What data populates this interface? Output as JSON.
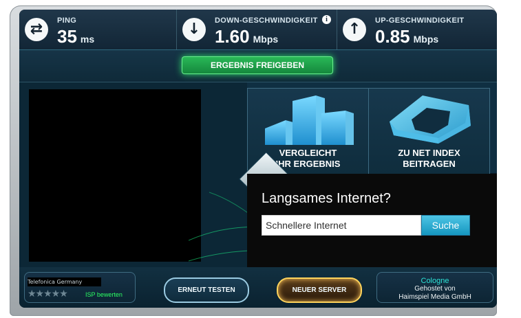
{
  "metrics": {
    "ping": {
      "label": "PING",
      "value": "35",
      "unit": "ms",
      "icon": "swap-icon"
    },
    "down": {
      "label": "DOWN-GESCHWINDIGKEIT",
      "value": "1.60",
      "unit": "Mbps",
      "icon": "download-arrow-icon",
      "info_symbol": "i"
    },
    "up": {
      "label": "UP-GESCHWINDIGKEIT",
      "value": "0.85",
      "unit": "Mbps",
      "icon": "upload-arrow-icon"
    }
  },
  "share": {
    "label": "ERGEBNIS FREIGEBEN",
    "accent": "#2fe06a"
  },
  "cards": [
    {
      "title_line1": "VERGLEICHT",
      "title_line2": "IHR ERGEBNIS",
      "icon": "bar-chart-icon"
    },
    {
      "title_line1": "ZU NET INDEX",
      "title_line2": "BEITRAGEN",
      "icon": "stacked-ring-icon"
    }
  ],
  "search": {
    "title": "Langsames Internet?",
    "input_value": "Schnellere Internet",
    "button_label": "Suche"
  },
  "bottom": {
    "isp_label": "Telefonica Germany",
    "stars": "★★★★★",
    "rate_isp_label": "ISP bewerten",
    "retest_label": "ERNEUT TESTEN",
    "new_server_label": "NEUER SERVER",
    "server_city": "Cologne",
    "server_host_line1": "Gehostet von",
    "server_host_line2": "Haimspiel Media GmbH"
  }
}
